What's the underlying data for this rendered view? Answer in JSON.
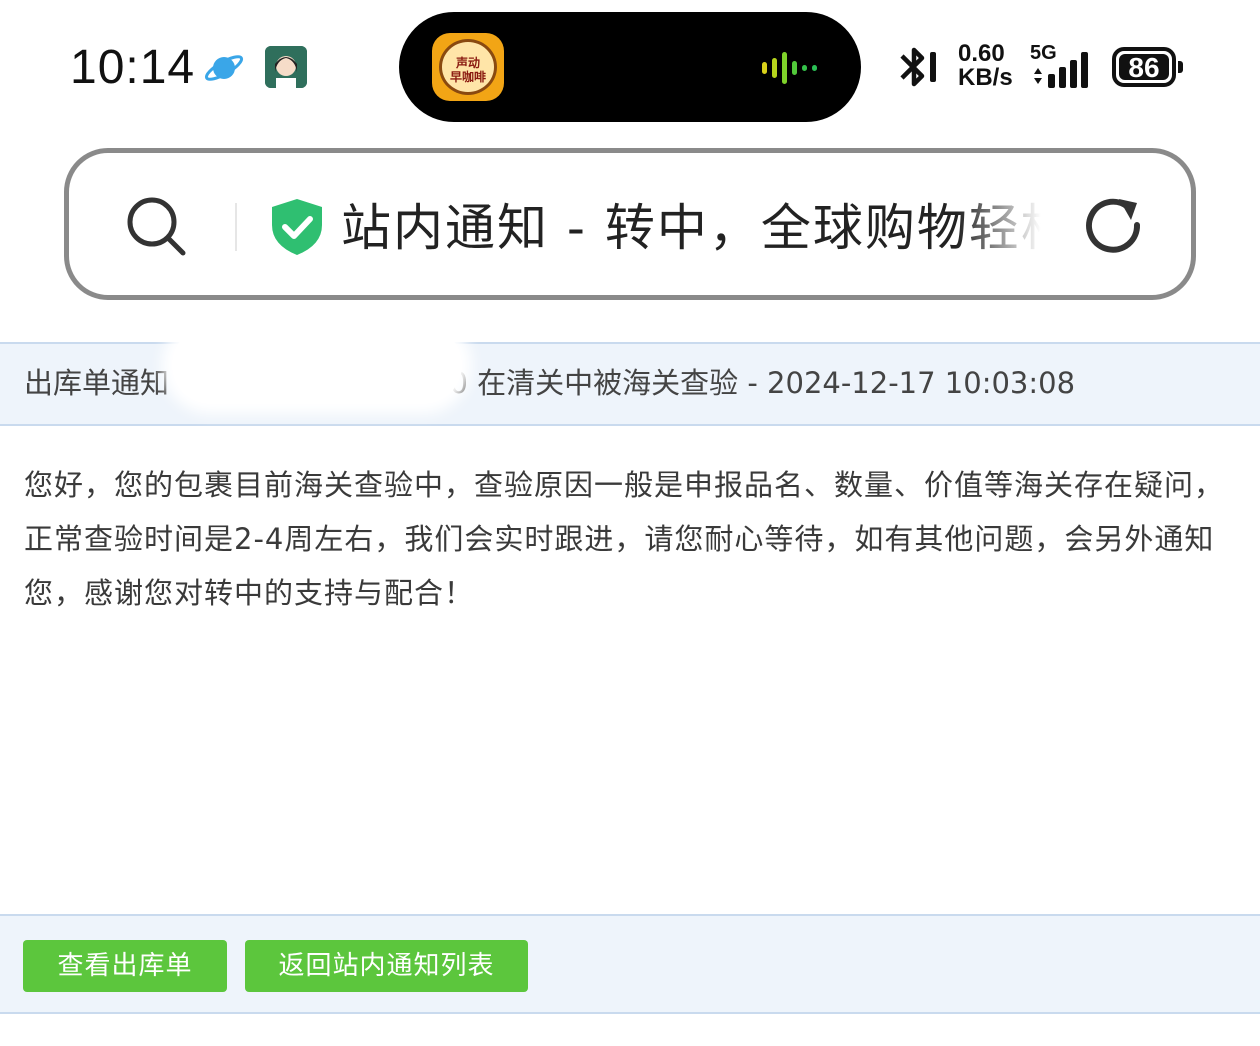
{
  "status_bar": {
    "time": "10:14",
    "app_thumb_text": "声动\n早咖啡",
    "net_speed_value": "0.60",
    "net_speed_unit": "KB/s",
    "network_type": "5G",
    "battery_level": "86",
    "icons": [
      "planet-icon",
      "avatar",
      "waveform-icon",
      "bluetooth-icon",
      "signal-icon",
      "battery-icon"
    ]
  },
  "address_bar": {
    "page_title": "站内通知 - 转中，全球购物轻松",
    "icons": [
      "search-icon",
      "shield-check-icon",
      "reload-icon"
    ],
    "colors": {
      "shield": "#2fbf71",
      "border": "#8a8a8a"
    }
  },
  "notice": {
    "title_prefix": "出库单通知",
    "title_suffix": "00 在清关中被海关查验 - 2024-12-17 10:03:08",
    "body": "您好，您的包裹目前海关查验中，查验原因一般是申报品名、数量、价值等海关存在疑问，正常查验时间是2-4周左右，我们会实时跟进，请您耐心等待，如有其他问题，会另外通知您，感谢您对转中的支持与配合！"
  },
  "footer": {
    "view_order_label": "查看出库单",
    "back_label": "返回站内通知列表",
    "colors": {
      "button": "#5cc63d",
      "panel": "#eef4fb"
    }
  }
}
